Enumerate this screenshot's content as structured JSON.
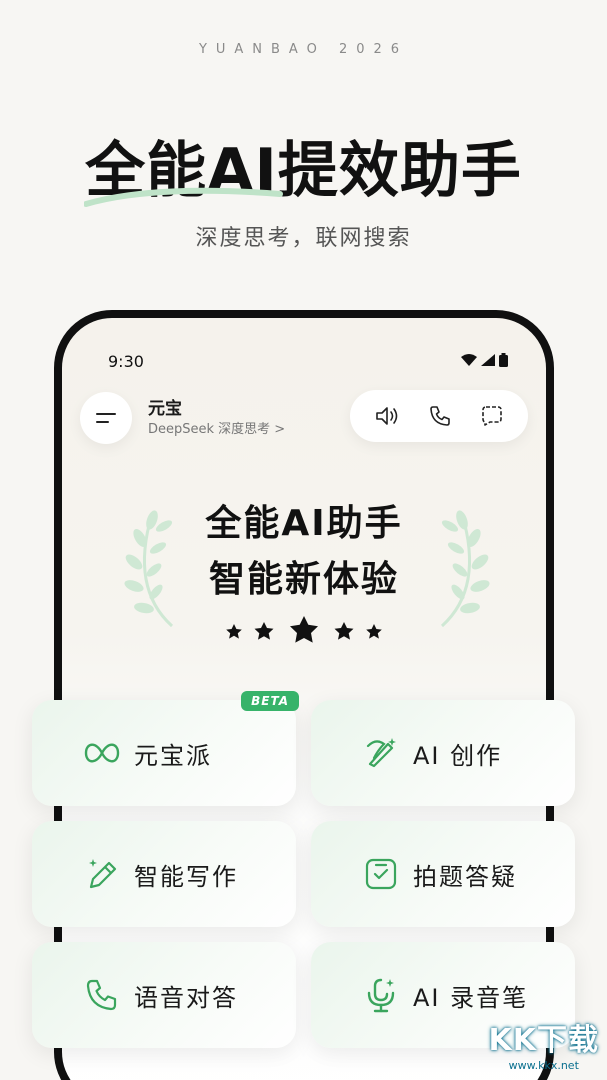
{
  "brand_line": "YUANBAO 2026",
  "hero": {
    "title": "全能AI提效助手",
    "subtitle": "深度思考，联网搜索"
  },
  "phone": {
    "status_time": "9:30",
    "chat": {
      "name": "元宝",
      "model": "DeepSeek 深度思考 >"
    },
    "feature_title_line1": "全能AI助手",
    "feature_title_line2": "智能新体验"
  },
  "cards": [
    {
      "label": "元宝派",
      "icon": "infinity-icon",
      "badge": "BETA"
    },
    {
      "label": "AI 创作",
      "icon": "magic-brush-icon"
    },
    {
      "label": "智能写作",
      "icon": "pencil-sparkle-icon"
    },
    {
      "label": "拍题答疑",
      "icon": "check-document-icon"
    },
    {
      "label": "语音对答",
      "icon": "phone-icon"
    },
    {
      "label": "AI 录音笔",
      "icon": "microphone-icon"
    }
  ],
  "watermark": {
    "big": "KK下载",
    "small": "www.kkx.net"
  },
  "colors": {
    "accent": "#37b36a",
    "icon_green": "#3aa55d",
    "laurel": "#cfe8d4"
  }
}
